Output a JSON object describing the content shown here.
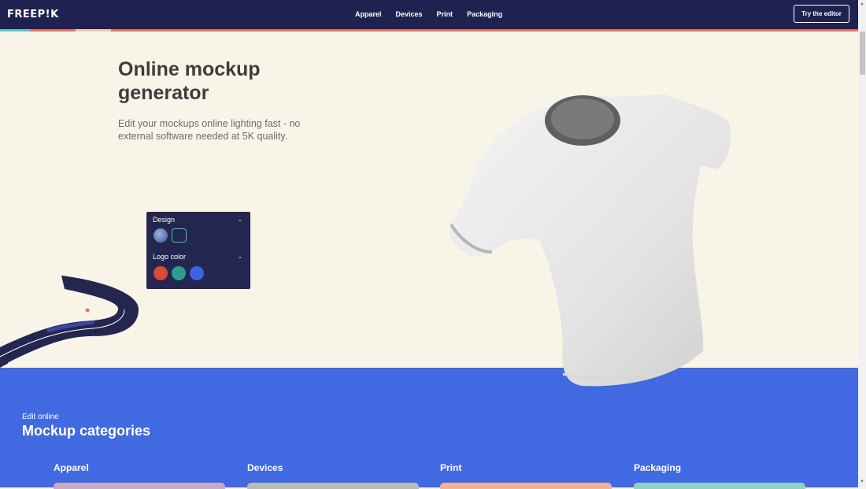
{
  "nav": {
    "logo": "FREEP!K",
    "links": [
      "Apparel",
      "Devices",
      "Print",
      "Packaging"
    ],
    "cta": "Try the editor"
  },
  "hero": {
    "title": "Online mockup generator",
    "subtitle": "Edit your mockups online lighting fast - no external software needed at 5K quality."
  },
  "panel": {
    "design_label": "Design",
    "logo_color_label": "Logo color",
    "colors": [
      "#d84a33",
      "#2a9d8f",
      "#3d63e0"
    ]
  },
  "categories": {
    "eyebrow": "Edit online",
    "title": "Mockup categories",
    "items": [
      "Apparel",
      "Devices",
      "Print",
      "Packaging"
    ],
    "card_colors": [
      "#c7a9c9",
      "#b9b9b9",
      "#f1b19b",
      "#8fd1c4"
    ]
  },
  "colors": {
    "nav_bg": "#1f2251",
    "hero_bg": "#f8f5e8",
    "blue": "#4169e1",
    "accent": "#e8735c"
  }
}
